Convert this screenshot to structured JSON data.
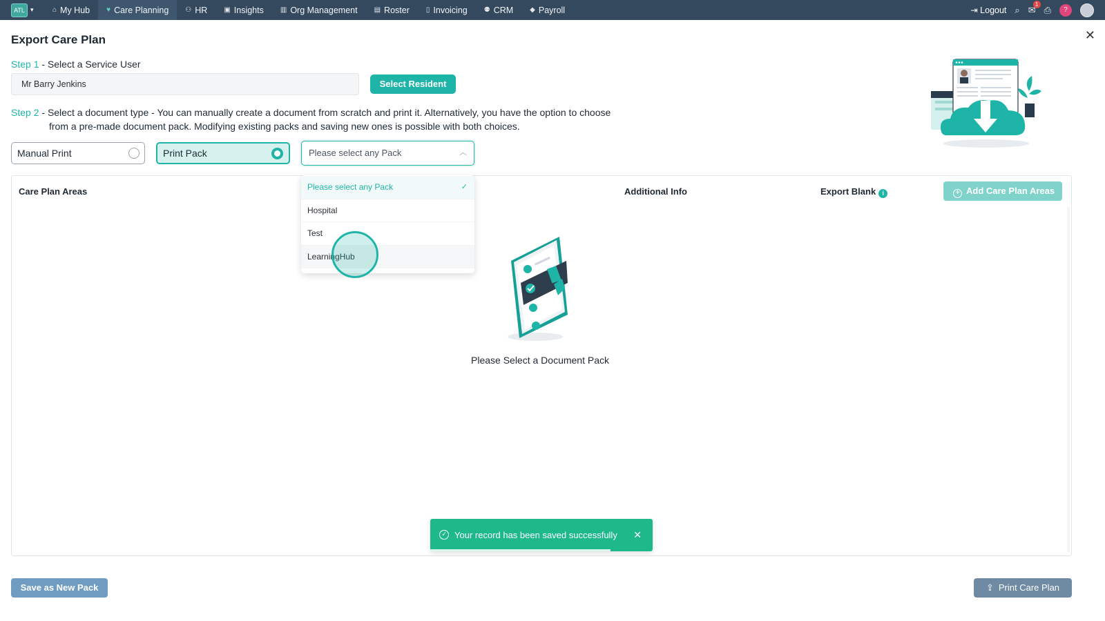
{
  "nav": {
    "brand": "ATL",
    "items": [
      {
        "label": "My Hub",
        "icon": "home-icon",
        "glyph": "⌂"
      },
      {
        "label": "Care Planning",
        "icon": "heart-icon",
        "glyph": "♥"
      },
      {
        "label": "HR",
        "icon": "users-icon",
        "glyph": "⚇"
      },
      {
        "label": "Insights",
        "icon": "chart-icon",
        "glyph": "▣"
      },
      {
        "label": "Org Management",
        "icon": "building-icon",
        "glyph": "▥"
      },
      {
        "label": "Roster",
        "icon": "calendar-icon",
        "glyph": "▤"
      },
      {
        "label": "Invoicing",
        "icon": "file-icon",
        "glyph": "▯"
      },
      {
        "label": "CRM",
        "icon": "contacts-icon",
        "glyph": "⚉"
      },
      {
        "label": "Payroll",
        "icon": "tag-icon",
        "glyph": "◆"
      }
    ],
    "logout_label": "Logout",
    "mail_badge": "1",
    "help_label": "?"
  },
  "page": {
    "title": "Export Care Plan"
  },
  "step1": {
    "label": "Step 1",
    "text": " - Select a Service User",
    "service_user": "Mr Barry Jenkins",
    "select_button": "Select Resident"
  },
  "step2": {
    "label": "Step 2",
    "sep": " - ",
    "highlight": "Select a document type",
    "text": " - You can manually create a document from scratch and print it. Alternatively, you have the option to choose",
    "text2": "from a pre-made document pack. Modifying existing packs and saving new ones is possible with both choices."
  },
  "doc_type": {
    "manual_label": "Manual Print",
    "pack_label": "Print Pack",
    "selected": "Print Pack"
  },
  "pack_select": {
    "placeholder": "Please select any Pack",
    "options": [
      "Please select any Pack",
      "Hospital",
      "Test",
      "LearningHub"
    ],
    "selected": "Please select any Pack",
    "hovered": "LearningHub"
  },
  "table": {
    "columns": [
      "Care Plan Areas",
      "Additional Info",
      "Export Blank"
    ],
    "add_button": "Add Care Plan Areas",
    "empty_text": "Please Select a Document Pack"
  },
  "toast": {
    "message": "Your record has been saved successfully",
    "progress": 0.81
  },
  "footer": {
    "save_pack": "Save as New Pack",
    "print": "Print Care Plan"
  },
  "colors": {
    "nav_bg": "#34495e",
    "accent": "#1eb5a8",
    "toast": "#1eb98a"
  }
}
